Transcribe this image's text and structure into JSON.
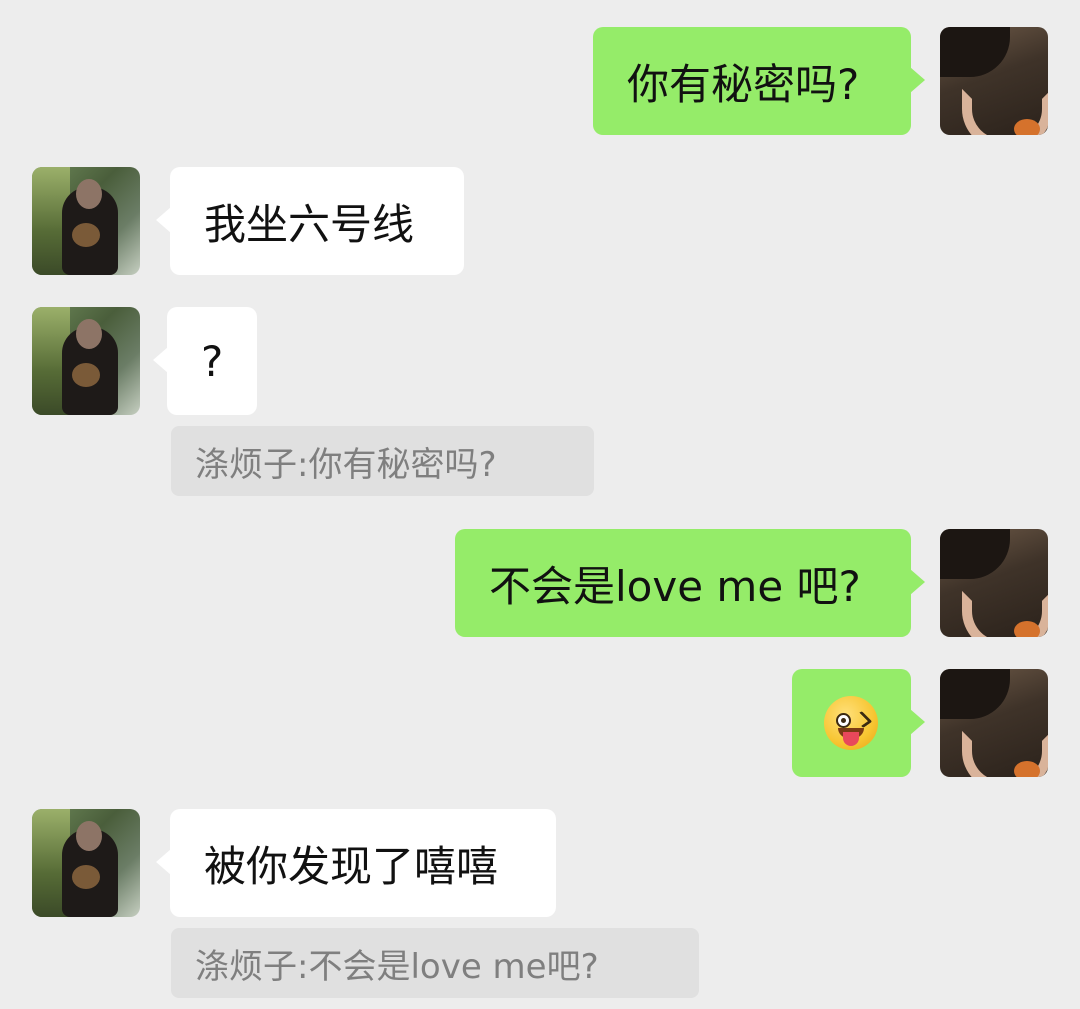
{
  "messages": [
    {
      "sender": "me",
      "text": "你有秘密吗?"
    },
    {
      "sender": "other",
      "text": "我坐六号线"
    },
    {
      "sender": "other",
      "text": "?",
      "quote": "涤烦子:你有秘密吗?"
    },
    {
      "sender": "me",
      "text": "不会是love me 吧?"
    },
    {
      "sender": "me",
      "emoji": "winking-face-with-tongue-emoji"
    },
    {
      "sender": "other",
      "text": "被你发现了嘻嘻",
      "quote": "涤烦子:不会是love me吧?"
    }
  ],
  "colors": {
    "background": "#ededed",
    "my_bubble": "#95ec69",
    "their_bubble": "#ffffff",
    "quote_bg": "#e0e0e0",
    "quote_text": "#7f7f7f"
  }
}
